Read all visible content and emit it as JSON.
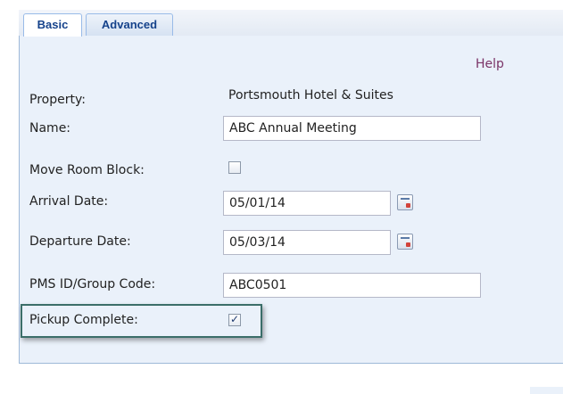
{
  "tabs": [
    {
      "label": "Basic",
      "active": true
    },
    {
      "label": "Advanced",
      "active": false
    }
  ],
  "help_label": "Help",
  "form": {
    "property_label": "Property:",
    "property_value": "Portsmouth Hotel & Suites",
    "name_label": "Name:",
    "name_value": "ABC Annual Meeting",
    "move_room_block_label": "Move Room Block:",
    "move_room_block_checked": false,
    "arrival_date_label": "Arrival Date:",
    "arrival_date_value": "05/01/14",
    "departure_date_label": "Departure Date:",
    "departure_date_value": "05/03/14",
    "pms_label": "PMS ID/Group Code:",
    "pms_value": "ABC0501",
    "pickup_complete_label": "Pickup Complete:",
    "pickup_complete_checked": true
  },
  "icons": {
    "calendar": "calendar-icon",
    "checkmark": "checkmark-icon"
  },
  "colors": {
    "tab_text": "#15428b",
    "panel_bg": "#eaf1fa",
    "help_link": "#7a3366",
    "highlight_border": "#3b6e69"
  }
}
